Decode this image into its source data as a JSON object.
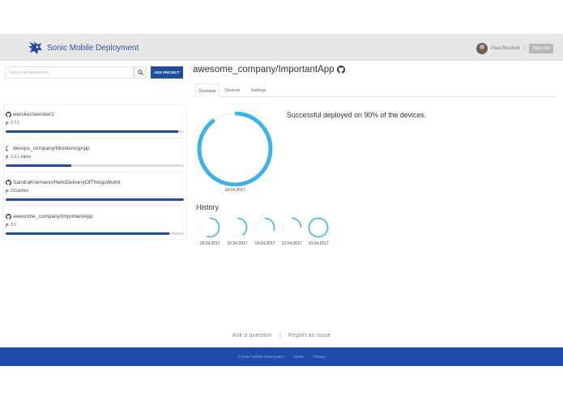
{
  "navbar": {
    "brand": "Sonic Mobile Deployment",
    "user_name": "Paul Reichelt",
    "separator": "|",
    "sign_out": "Sign out"
  },
  "sidebar": {
    "search_placeholder": "Search all repositories",
    "add_project": "ADD PROJECT",
    "repos": [
      {
        "name": "wercker/wercker2",
        "version": "2.7.1",
        "progress": 0.97
      },
      {
        "name": "devops_company/MonitoringApp",
        "version": "0.3.1-alpha",
        "progress": 0.37
      },
      {
        "name": "SandraKriemann/HelloDeliveryOfThingsWorld",
        "version": "201de8bd",
        "progress": 1.0
      },
      {
        "name": "awesome_company/ImportantApp",
        "version": "3.1",
        "progress": 0.92
      }
    ]
  },
  "main": {
    "title": "awesome_company/ImportantApp",
    "tabs": [
      "Overview",
      "Devices",
      "Settings"
    ],
    "active_tab": "Overview",
    "current": {
      "date": "19.04.2017",
      "percent": 90,
      "message": "Successful deployed on 90% of the devices."
    },
    "history_title": "History",
    "history": [
      {
        "date": "18.04.2017",
        "percent": 55
      },
      {
        "date": "16.04.2017",
        "percent": 40
      },
      {
        "date": "14.04.2017",
        "percent": 30
      },
      {
        "date": "12.04.2017",
        "percent": 25
      },
      {
        "date": "10.04.2017",
        "percent": 100
      }
    ]
  },
  "footer": {
    "ask_question": "Ask a question",
    "link_sep": "|",
    "report_issue": "Report an issue",
    "copyright": "© Sonic Mobile Deployment",
    "home": "Home",
    "dot": "·",
    "privacy": "Privacy"
  },
  "colors": {
    "accent": "#3db1e8",
    "brand": "#1f4f9b",
    "footer": "#1f4bac"
  },
  "icons": {
    "brand": "sonic-logo-icon",
    "search": "search-icon",
    "github": "github-icon",
    "tag": "tag-icon"
  }
}
